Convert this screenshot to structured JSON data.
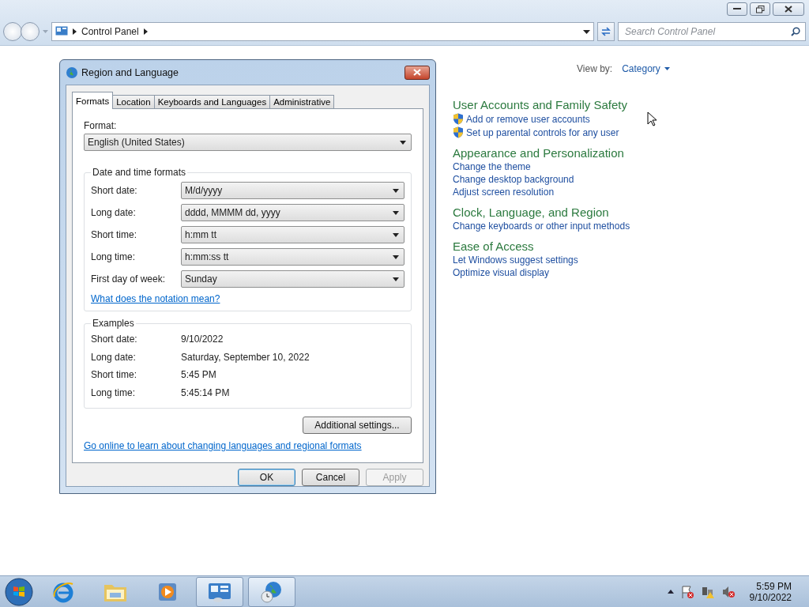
{
  "address_bar": {
    "breadcrumb": [
      "Control Panel"
    ]
  },
  "search": {
    "placeholder": "Search Control Panel"
  },
  "view_by": {
    "label": "View by:",
    "value": "Category"
  },
  "categories": [
    {
      "title": "User Accounts and Family Safety",
      "links": [
        {
          "text": "Add or remove user accounts",
          "shield": true
        },
        {
          "text": "Set up parental controls for any user",
          "shield": true
        }
      ]
    },
    {
      "title": "Appearance and Personalization",
      "links": [
        {
          "text": "Change the theme",
          "shield": false
        },
        {
          "text": "Change desktop background",
          "shield": false
        },
        {
          "text": "Adjust screen resolution",
          "shield": false
        }
      ]
    },
    {
      "title": "Clock, Language, and Region",
      "links": [
        {
          "text": "Change keyboards or other input methods",
          "shield": false
        }
      ]
    },
    {
      "title": "Ease of Access",
      "links": [
        {
          "text": "Let Windows suggest settings",
          "shield": false
        },
        {
          "text": "Optimize visual display",
          "shield": false
        }
      ]
    }
  ],
  "dialog": {
    "title": "Region and Language",
    "tabs": [
      {
        "label": "Formats",
        "selected": true
      },
      {
        "label": "Location",
        "selected": false
      },
      {
        "label": "Keyboards and Languages",
        "selected": false
      },
      {
        "label": "Administrative",
        "selected": false
      }
    ],
    "format_label": "Format:",
    "format_value": "English (United States)",
    "date_time_group": {
      "title": "Date and time formats",
      "rows": [
        {
          "label": "Short date:",
          "value": "M/d/yyyy"
        },
        {
          "label": "Long date:",
          "value": "dddd, MMMM dd, yyyy"
        },
        {
          "label": "Short time:",
          "value": "h:mm tt"
        },
        {
          "label": "Long time:",
          "value": "h:mm:ss tt"
        },
        {
          "label": "First day of week:",
          "value": "Sunday"
        }
      ]
    },
    "notation_link": "What does the notation mean?",
    "examples": {
      "title": "Examples",
      "rows": [
        {
          "label": "Short date:",
          "value": "9/10/2022"
        },
        {
          "label": "Long date:",
          "value": "Saturday, September 10, 2022"
        },
        {
          "label": "Short time:",
          "value": "5:45 PM"
        },
        {
          "label": "Long time:",
          "value": "5:45:14 PM"
        }
      ]
    },
    "additional_button": "Additional settings...",
    "online_link": "Go online to learn about changing languages and regional formats",
    "buttons": [
      {
        "label": "OK",
        "default": true,
        "disabled": false
      },
      {
        "label": "Cancel",
        "default": false,
        "disabled": false
      },
      {
        "label": "Apply",
        "default": false,
        "disabled": true
      }
    ]
  },
  "taskbar": {
    "apps": [
      {
        "kind": "ie",
        "open": false
      },
      {
        "kind": "explorer",
        "open": false
      },
      {
        "kind": "media",
        "open": false
      },
      {
        "kind": "control",
        "open": true
      },
      {
        "kind": "globe",
        "open": true
      }
    ],
    "clock": {
      "time": "5:59 PM",
      "date": "9/10/2022"
    }
  }
}
